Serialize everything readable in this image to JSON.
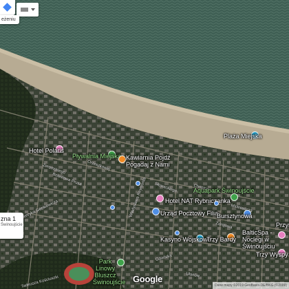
{
  "map": {
    "controls": {
      "partial_label": "eżeniu"
    },
    "info_card": {
      "title": "zna 1",
      "subtitle": "Świnoujście"
    },
    "labels": [
      {
        "text": "Plaża Miejska",
        "color": "white"
      },
      {
        "text": "Hotel Polaris",
        "color": "white"
      },
      {
        "text": "Pływalnia Miejska",
        "color": "green"
      },
      {
        "text": "Kawiarnia Pojdź Pogadaj z Nami",
        "color": "white"
      },
      {
        "text": "Aquapark Świnoujście",
        "color": "green"
      },
      {
        "text": "Hotel NAT Rybniczanka",
        "color": "white"
      },
      {
        "text": "Urząd Pocztowy Filia",
        "color": "white"
      },
      {
        "text": "Bursztynowa",
        "color": "white"
      },
      {
        "text": "Kasyno Wojskowe",
        "color": "white"
      },
      {
        "text": "Trzy Bardy",
        "color": "white"
      },
      {
        "text": "BalticSpa - Noclegi w Świnoujściu",
        "color": "white"
      },
      {
        "text": "Park Linowy Bluszcz Świnoujście",
        "color": "green"
      },
      {
        "text": "Trzy Wyspy",
        "color": "white"
      },
      {
        "text": "Przym",
        "color": "white"
      }
    ],
    "streets": [
      "Żeromskiego",
      "Bolesława Prusa",
      "Henryka Sienkiewicza",
      "Orzeszkowej",
      "Władysława Reymonta",
      "Słowackiego",
      "Chopina",
      "Zdrojowa",
      "Gdańska",
      "Tadeusza Kościuszki",
      "Mickiewicza",
      "Ułanów"
    ],
    "logo": "Google",
    "footer": "Dane mapy ©2019 GeoBasis-DE/BKG (©2009)"
  }
}
